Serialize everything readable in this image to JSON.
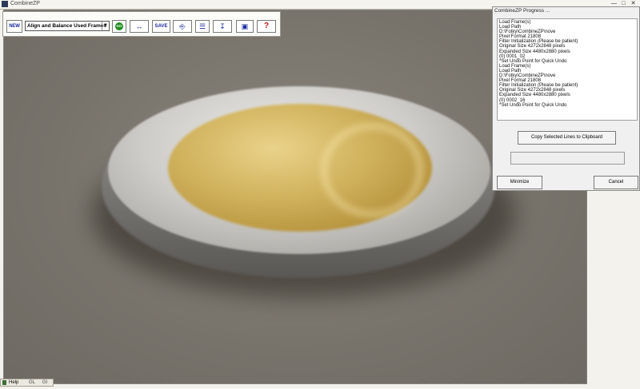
{
  "window": {
    "title": "CombineZP"
  },
  "document": {
    "label": "0002_16"
  },
  "toolbar": {
    "new_label": "NEW",
    "macro_selected": "Align and Balance Used Frames",
    "go_label": "GO",
    "save_label": "SAVE",
    "help_label": "?"
  },
  "progress_dialog": {
    "title": "CombineZP Progress ...",
    "log_lines": [
      "Load Frame(s)",
      "Load Path",
      "   D:\\Fotky\\CombineZP\\nove",
      "Pixel Format 21808",
      "Filter Initialization (Please be patient)",
      "Original Size 4272x2848 pixels",
      "Expanded Size 4480x2880 pixels",
      "(0) 0001_02",
      "*Set Undo Point for Quick Undo",
      "Load Frame(s)",
      "Load Path",
      "   D:\\Fotky\\CombineZP\\nove",
      "Pixel Format 21808",
      "Filter Initialization (Please be patient)",
      "Original Size 4272x2848 pixels",
      "Expanded Size 4480x2880 pixels",
      "(0) 0002_16",
      "*Set Undo Point for Quick Undo"
    ],
    "copy_label": "Copy Selected Lines to Clipboard",
    "minimize_label": "Minimize",
    "cancel_label": "Cancel"
  },
  "statusbar": {
    "help_label": "Help",
    "seg1": "GL",
    "seg2": "GI"
  },
  "colors": {
    "go_green": "#1e8c1e",
    "help_red": "#c81414",
    "tool_blue": "#1a2a9c"
  }
}
